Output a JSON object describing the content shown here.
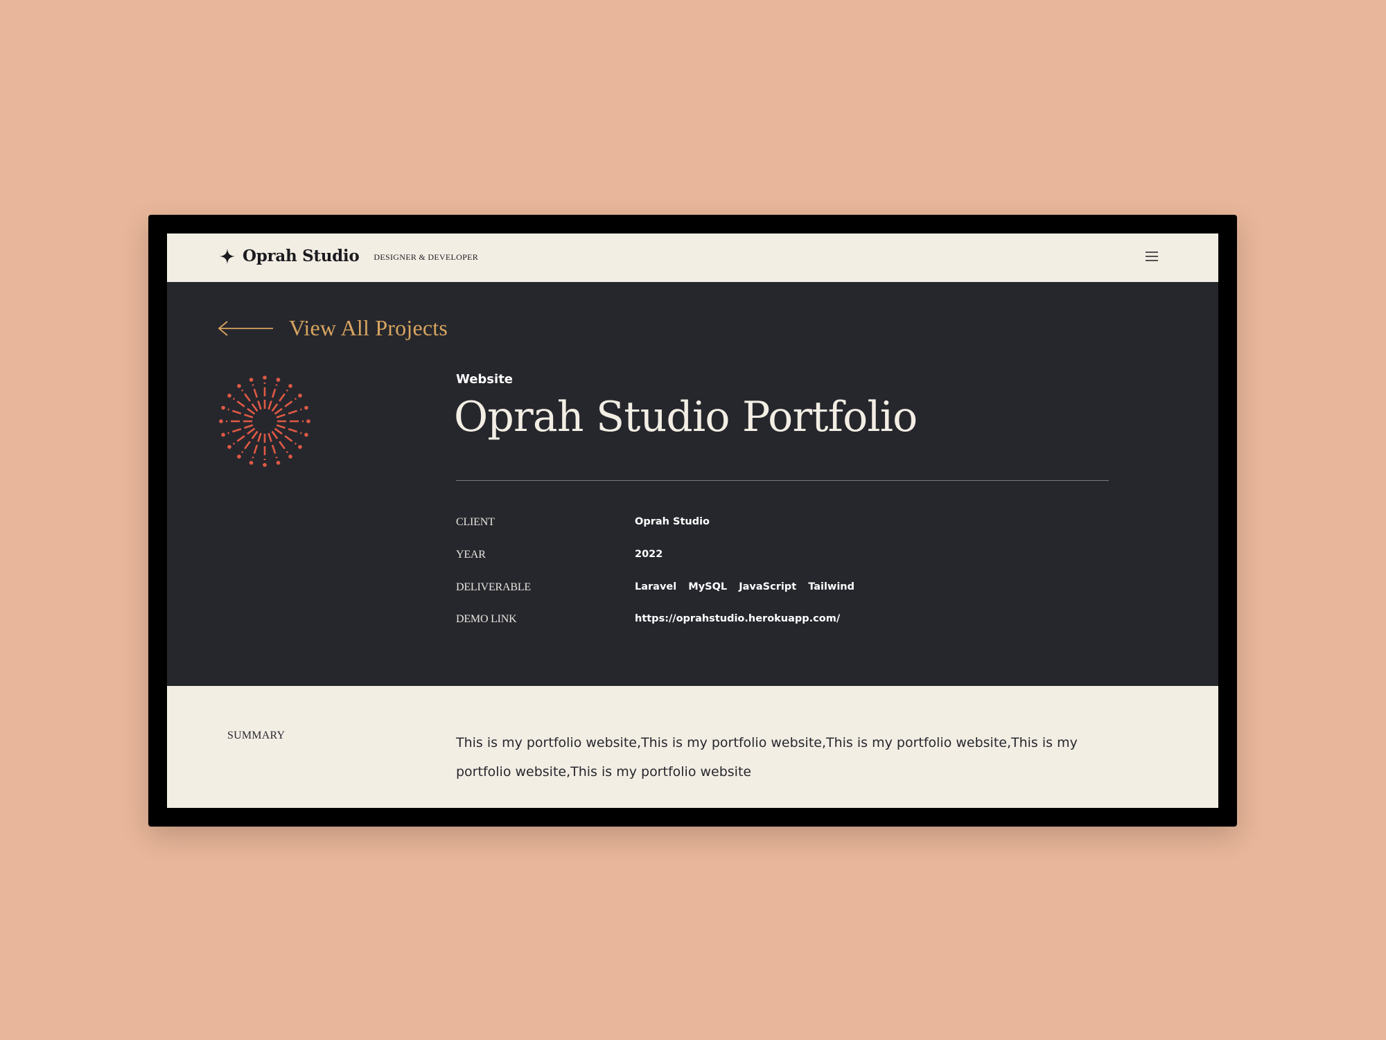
{
  "header": {
    "brand_name": "Oprah Studio",
    "brand_tagline": "DESIGNER & DEVELOPER",
    "brand_icon": "sparkle-star-icon",
    "menu_icon": "hamburger-menu-icon"
  },
  "hero": {
    "back_label": "View All Projects",
    "back_icon": "arrow-left-icon",
    "decoration_icon": "sunburst-icon",
    "category": "Website",
    "title": "Oprah Studio Portfolio",
    "details": [
      {
        "label": "CLIENT",
        "value": "Oprah Studio"
      },
      {
        "label": "YEAR",
        "value": "2022"
      },
      {
        "label": "DELIVERABLE",
        "tags": [
          "Laravel",
          "MySQL",
          "JavaScript",
          "Tailwind"
        ]
      },
      {
        "label": "DEMO LINK",
        "value": "https://oprahstudio.herokuapp.com/"
      }
    ]
  },
  "summary": {
    "label": "SUMMARY",
    "text": "This is my portfolio website,This is my portfolio website,This is my portfolio website,This is my portfolio website,This is my portfolio website"
  },
  "colors": {
    "page_background": "#e8b69a",
    "dark_panel": "#26272d",
    "cream": "#f3eee4",
    "accent_gold": "#d8a560",
    "accent_red": "#e05a45"
  }
}
